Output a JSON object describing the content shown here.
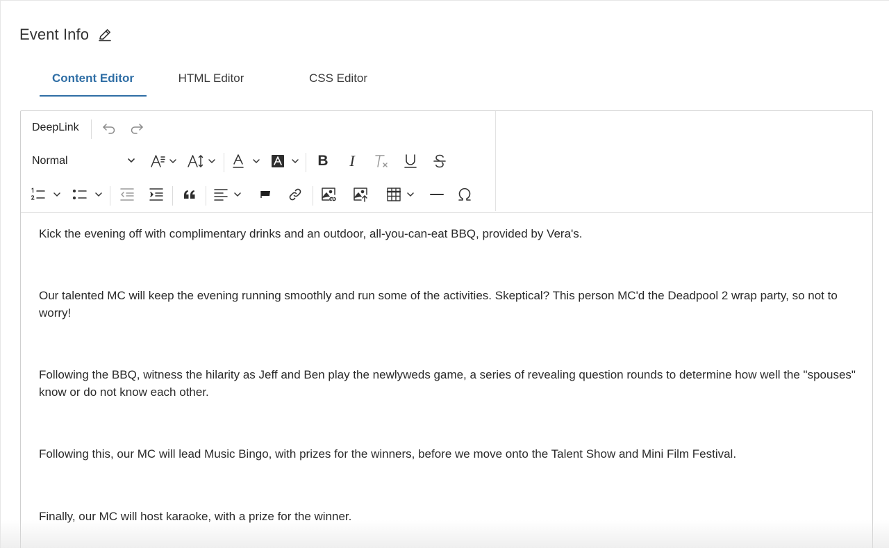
{
  "header": {
    "title": "Event Info",
    "edit_icon": "pencil-icon"
  },
  "tabs": [
    {
      "label": "Content Editor",
      "active": true
    },
    {
      "label": "HTML Editor",
      "active": false
    },
    {
      "label": "CSS Editor",
      "active": false
    }
  ],
  "toolbar": {
    "deeplink_label": "DeepLink",
    "format_value": "Normal",
    "icons": [
      "undo-icon",
      "redo-icon",
      "font-size-icon",
      "line-height-icon",
      "font-color-icon",
      "background-color-icon",
      "bold-icon",
      "italic-icon",
      "clear-format-icon",
      "underline-icon",
      "strikethrough-icon",
      "ordered-list-icon",
      "bullet-list-icon",
      "outdent-icon",
      "indent-icon",
      "blockquote-icon",
      "align-icon",
      "flag-icon",
      "link-icon",
      "image-link-icon",
      "image-upload-icon",
      "table-icon",
      "horizontal-rule-icon",
      "special-character-icon"
    ],
    "bold_glyph": "B",
    "italic_glyph": "I"
  },
  "content": {
    "paragraphs": [
      "Kick the evening off with complimentary drinks and an outdoor, all-you-can-eat BBQ, provided by Vera's.",
      "Our talented MC will keep the evening running smoothly and run some of the activities. Skeptical? This person MC'd the Deadpool 2 wrap party, so not to worry!",
      "Following the BBQ, witness the hilarity as Jeff and Ben play the newlyweds game, a series of revealing question rounds to determine how well the \"spouses\" know or do not know each other.",
      "Following this, our MC will lead Music Bingo, with prizes for the winners, before we move onto the Talent Show and Mini Film Festival.",
      "Finally, our MC will host karaoke, with a prize for the winner."
    ]
  },
  "colors": {
    "accent": "#2f6ea5",
    "text": "#2a2a2a",
    "border": "#cfcfcf"
  }
}
